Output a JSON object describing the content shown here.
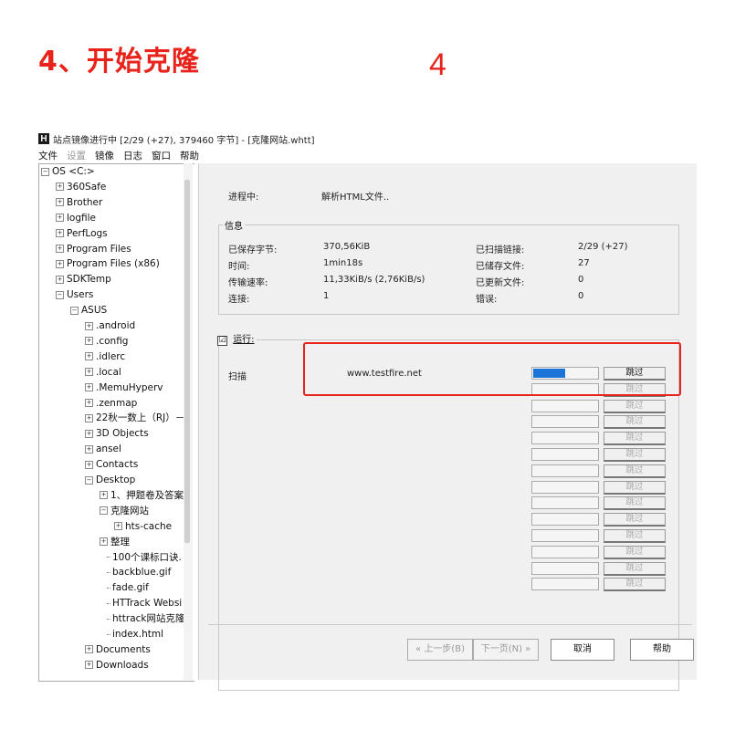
{
  "header": {
    "step_title": "4、开始克隆",
    "step_number": "4"
  },
  "window": {
    "title": "站点镜像进行中 [2/29 (+27), 379460 字节] - [克隆网站.whtt]",
    "app_icon": "H",
    "menu": [
      "文件",
      "设置",
      "镜像",
      "日志",
      "窗口",
      "帮助"
    ]
  },
  "tree": {
    "items": [
      {
        "label": "OS <C:>",
        "box": "−"
      },
      {
        "label": "360Safe",
        "box": "+"
      },
      {
        "label": "Brother",
        "box": "+"
      },
      {
        "label": "logfile",
        "box": "+"
      },
      {
        "label": "PerfLogs",
        "box": "+"
      },
      {
        "label": "Program Files",
        "box": "+"
      },
      {
        "label": "Program Files (x86)",
        "box": "+"
      },
      {
        "label": "SDKTemp",
        "box": "+"
      },
      {
        "label": "Users",
        "box": "−"
      },
      {
        "label": "ASUS",
        "box": "−"
      },
      {
        "label": ".android",
        "box": "+"
      },
      {
        "label": ".config",
        "box": "+"
      },
      {
        "label": ".idlerc",
        "box": "+"
      },
      {
        "label": ".local",
        "box": "+"
      },
      {
        "label": ".MemuHyperv",
        "box": "+"
      },
      {
        "label": ".zenmap",
        "box": "+"
      },
      {
        "label": "22秋一数上（RJ）－",
        "box": "+"
      },
      {
        "label": "3D Objects",
        "box": "+"
      },
      {
        "label": "ansel",
        "box": "+"
      },
      {
        "label": "Contacts",
        "box": "+"
      },
      {
        "label": "Desktop",
        "box": "−"
      },
      {
        "label": "1、押题卷及答案",
        "box": "+"
      },
      {
        "label": "克隆网站",
        "box": "−"
      },
      {
        "label": "hts-cache",
        "box": "+"
      },
      {
        "label": "整理",
        "box": "+"
      },
      {
        "label": "100个课标口诀.",
        "box": ""
      },
      {
        "label": "backblue.gif",
        "box": ""
      },
      {
        "label": "fade.gif",
        "box": ""
      },
      {
        "label": "HTTrack Websi",
        "box": ""
      },
      {
        "label": "httrack网站克隆",
        "box": ""
      },
      {
        "label": "index.html",
        "box": ""
      },
      {
        "label": "Documents",
        "box": "+"
      },
      {
        "label": "Downloads",
        "box": "+"
      }
    ]
  },
  "progress": {
    "in_progress_label": "进程中:",
    "in_progress_value": "解析HTML文件..",
    "info_legend": "信息",
    "saved_bytes_label": "已保存字节:",
    "saved_bytes_value": "370,56KiB",
    "time_label": "时间:",
    "time_value": "1min18s",
    "rate_label": "传输速率:",
    "rate_value": "11,33KiB/s (2,76KiB/s)",
    "connections_label": "连接:",
    "connections_value": "1",
    "links_scanned_label": "已扫描链接:",
    "links_scanned_value": "2/29 (+27)",
    "files_written_label": "已储存文件:",
    "files_written_value": "27",
    "files_updated_label": "已更新文件:",
    "files_updated_value": "0",
    "errors_label": "错误:",
    "errors_value": "0",
    "running_label": "运行:",
    "running_checked": "☑",
    "scan_label": "扫描",
    "scan_url": "www.testfire.net",
    "first_progress_fraction": 0.5,
    "skip_label": "跳过"
  },
  "buttons": {
    "prev": "« 上一步(B)",
    "next": "下一页(N) »",
    "cancel": "取消",
    "help": "帮助"
  },
  "colors": {
    "accent_red": "#e8231c",
    "progress_blue": "#1b74d8"
  }
}
